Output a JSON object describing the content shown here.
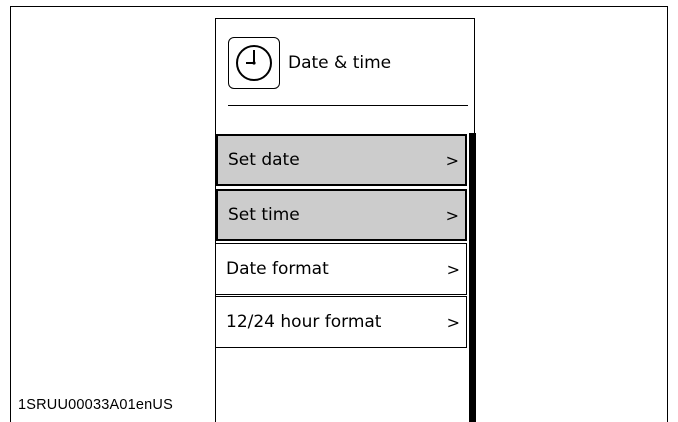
{
  "doc_id": "1SRUU00033A01enUS",
  "header": {
    "title": "Date & time",
    "icon": "clock-icon"
  },
  "menu": {
    "items": [
      {
        "label": "Set date",
        "chevron": ">",
        "selected": true
      },
      {
        "label": "Set time",
        "chevron": ">",
        "selected": true
      },
      {
        "label": "Date format",
        "chevron": ">",
        "selected": false
      },
      {
        "label": "12/24 hour format",
        "chevron": ">",
        "selected": false
      }
    ]
  },
  "colors": {
    "selected_bg": "#cccccc",
    "border": "#000000",
    "background": "#ffffff"
  }
}
